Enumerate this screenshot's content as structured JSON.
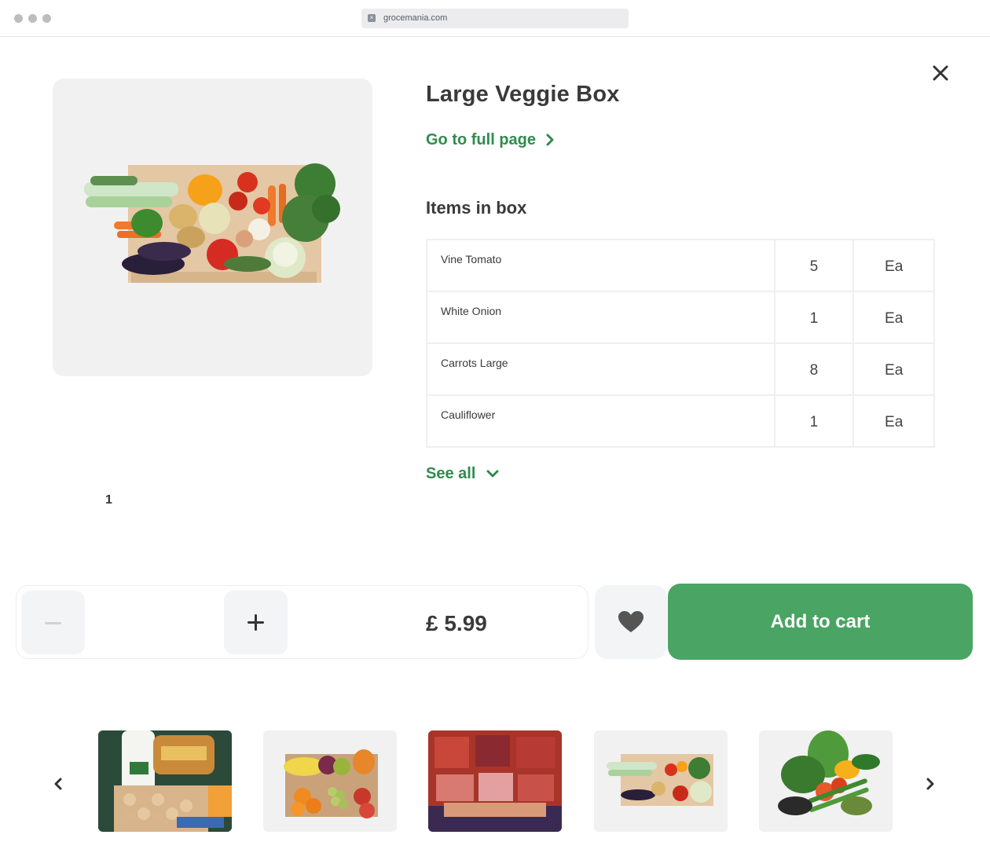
{
  "browser": {
    "url": "grocemania.com",
    "favicon": "close-square-icon"
  },
  "product": {
    "title": "Large Veggie Box",
    "full_page_link": "Go to full page",
    "image_page": "1"
  },
  "items_section": {
    "heading": "Items in box",
    "items": [
      {
        "name": "Vine Tomato",
        "qty": "5",
        "unit": "Ea"
      },
      {
        "name": "White Onion",
        "qty": "1",
        "unit": "Ea"
      },
      {
        "name": "Carrots Large",
        "qty": "8",
        "unit": "Ea"
      },
      {
        "name": "Cauliflower",
        "qty": "1",
        "unit": "Ea"
      }
    ],
    "see_all": "See all"
  },
  "purchase": {
    "price": "£ 5.99",
    "add_to_cart": "Add to cart",
    "quantity_icons": [
      "minus-icon",
      "plus-icon"
    ],
    "favourite_icon": "heart-icon"
  },
  "carousel": {
    "prev_icon": "chevron-left-icon",
    "next_icon": "chevron-right-icon",
    "thumbnails": [
      "breakfast-box",
      "fruit-box",
      "meat-box",
      "veggie-box",
      "salad-box"
    ]
  },
  "colors": {
    "accent_green": "#2f8c4e",
    "button_green": "#4aa463",
    "surface_grey": "#f1f1f1"
  }
}
